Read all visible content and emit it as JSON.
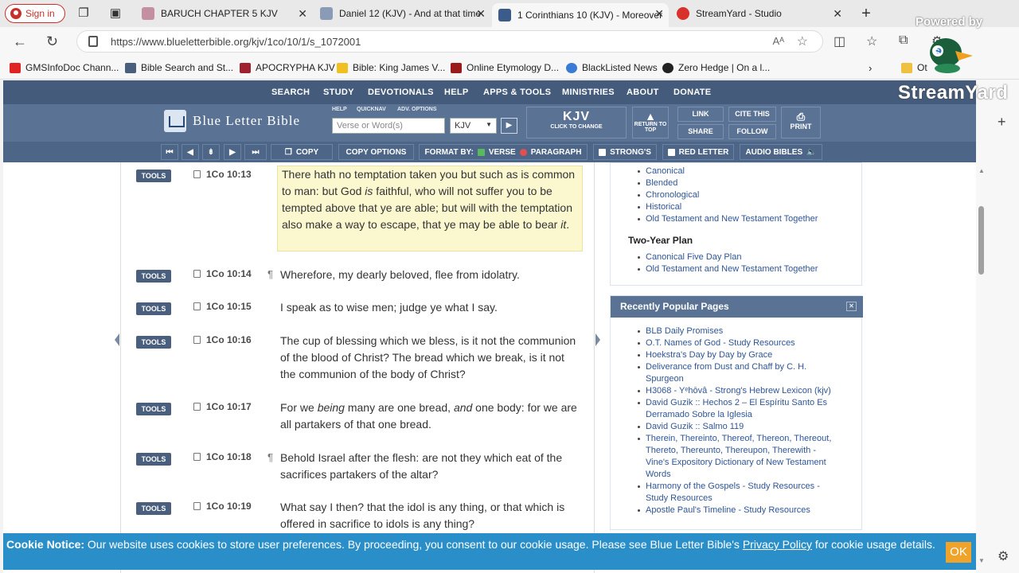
{
  "browser": {
    "signin_label": "Sign in",
    "tabs": [
      {
        "title": "BARUCH CHAPTER 5 KJV",
        "color": "#c48fa0"
      },
      {
        "title": "Daniel 12 (KJV) - And at that time",
        "color": "#8a9bb8"
      },
      {
        "title": "1 Corinthians 10 (KJV) - Moreover",
        "color": "#3b5b8a"
      },
      {
        "title": "StreamYard - Studio",
        "color": "#d9322c"
      }
    ],
    "url": "https://www.blueletterbible.org/kjv/1co/10/1/s_1072001",
    "bookmarks": [
      {
        "label": "GMSInfoDoc Chann...",
        "color": "#e02424"
      },
      {
        "label": "Bible Search and St...",
        "color": "#4a5f7e"
      },
      {
        "label": "APOCRYPHA KJV",
        "color": "#a02030"
      },
      {
        "label": "Bible: King James V...",
        "color": "#f0c020"
      },
      {
        "label": "Online Etymology D...",
        "color": "#9a1b1b"
      },
      {
        "label": "BlackListed News",
        "color": "#3a7bd5"
      },
      {
        "label": "Zero Hedge | On a l...",
        "color": "#222222"
      },
      {
        "label": "Ot",
        "color": "#f0c040"
      }
    ]
  },
  "site": {
    "topnav": [
      "SEARCH",
      "STUDY",
      "DEVOTIONALS",
      "HELP",
      "APPS & TOOLS",
      "MINISTRIES",
      "ABOUT",
      "DONATE"
    ],
    "logo": "Blue Letter Bible",
    "header_links": [
      "HELP",
      "QUICKNAV",
      "ADV. OPTIONS"
    ],
    "search_placeholder": "Verse or Word(s)",
    "version": "KJV",
    "kjv_big": "KJV",
    "kjv_small": "CLICK TO CHANGE",
    "return_top": "RETURN TO TOP",
    "link": "LINK",
    "cite": "CITE THIS",
    "share": "SHARE",
    "follow": "FOLLOW",
    "print": "PRINT",
    "toolbar": {
      "copy": "COPY",
      "copy_options": "COPY OPTIONS",
      "format_by": "FORMAT BY:",
      "verse": "VERSE",
      "paragraph": "PARAGRAPH",
      "strongs": "STRONG'S",
      "red_letter": "RED LETTER",
      "audio": "AUDIO BIBLES"
    }
  },
  "verses": [
    {
      "ref": "1Co 10:13",
      "para": "",
      "text": "There hath no temptation taken you but such as is common to man: but God is faithful, who will not suffer you to be tempted above that ye are able; but will with the temptation also make a way to escape, that ye may be able to bear it.",
      "highlight": true
    },
    {
      "ref": "1Co 10:14",
      "para": "¶",
      "text": "Wherefore, my dearly beloved, flee from idolatry.",
      "highlight": false
    },
    {
      "ref": "1Co 10:15",
      "para": "",
      "text": "I speak as to wise men; judge ye what I say.",
      "highlight": false
    },
    {
      "ref": "1Co 10:16",
      "para": "",
      "text": "The cup of blessing which we bless, is it not the communion of the blood of Christ? The bread which we break, is it not the communion of the body of Christ?",
      "highlight": false
    },
    {
      "ref": "1Co 10:17",
      "para": "",
      "text": "For we being many are one bread, and one body: for we are all partakers of that one bread.",
      "highlight": false
    },
    {
      "ref": "1Co 10:18",
      "para": "¶",
      "text": "Behold Israel after the flesh: are not they which eat of the sacrifices partakers of the altar?",
      "highlight": false
    },
    {
      "ref": "1Co 10:19",
      "para": "",
      "text": "What say I then? that the idol is any thing, or that which is offered in sacrifice to idols is any thing?",
      "highlight": false
    }
  ],
  "tools_label": "TOOLS",
  "sidebar": {
    "plan_links_top": [
      "Canonical",
      "Blended",
      "Chronological",
      "Historical",
      "Old Testament and New Testament Together"
    ],
    "two_year_title": "Two-Year Plan",
    "two_year_links": [
      "Canonical Five Day Plan",
      "Old Testament and New Testament Together"
    ],
    "popular_title": "Recently Popular Pages",
    "popular_links": [
      "BLB Daily Promises",
      "O.T. Names of God - Study Resources",
      "Hoekstra's Day by Day by Grace",
      "Deliverance from Dust and Chaff by C. H. Spurgeon",
      "H3068 - Yᵉhōvâ - Strong's Hebrew Lexicon (kjv)",
      "David Guzik :: Hechos 2 – El Espíritu Santo Es Derramado Sobre la Iglesia",
      "David Guzik :: Salmo 119",
      "Therein, Thereinto, Thereof, Thereon, Thereout, Thereto, Thereunto, Thereupon, Therewith - Vine's Expository Dictionary of New Testament Words",
      "Harmony of the Gospels - Study Resources - Study Resources",
      "Apostle Paul's Timeline - Study Resources"
    ]
  },
  "cookie": {
    "label": "Cookie Notice:",
    "text": " Our website uses cookies to store user preferences. By proceeding, you consent to our cookie usage. Please see Blue Letter Bible's ",
    "link": "Privacy Policy",
    "tail": " for cookie usage details.",
    "ok": "OK"
  },
  "overlay": {
    "powered": "Powered by",
    "brand": "StreamYard"
  }
}
